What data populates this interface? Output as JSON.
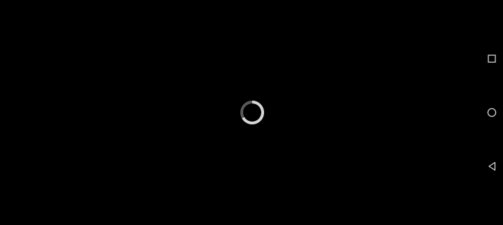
{
  "screen": {
    "state": "loading",
    "background_color": "#000000"
  },
  "spinner": {
    "icon": "loading-spinner-icon",
    "track_color": "#5a5a5a",
    "arc_color": "#d6d6d6"
  },
  "navigation_bar": {
    "orientation": "vertical-right",
    "icon_color": "#d8d8d8",
    "buttons": [
      {
        "name": "recents",
        "icon": "square-recents-icon"
      },
      {
        "name": "home",
        "icon": "circle-home-icon"
      },
      {
        "name": "back",
        "icon": "triangle-back-icon"
      }
    ]
  }
}
